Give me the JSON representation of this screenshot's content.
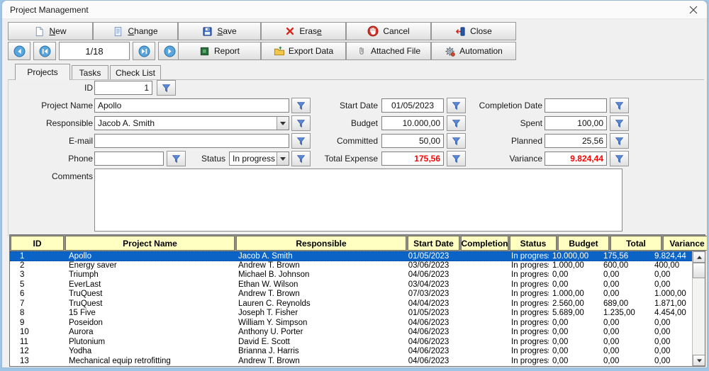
{
  "window": {
    "title": "Project Management"
  },
  "toolbar": {
    "new": {
      "label_html": "<u>N</u>ew"
    },
    "change": {
      "label_html": "<u>C</u>hange"
    },
    "save": {
      "label_html": "<u>S</u>ave"
    },
    "erase": {
      "label_html": "Eras<u>e</u>"
    },
    "cancel": {
      "label_html": "Cancel"
    },
    "close": {
      "label_html": "Close"
    },
    "report": {
      "label_html": "Report"
    },
    "export": {
      "label_html": "Export Data"
    },
    "attached": {
      "label_html": "Attached File"
    },
    "automation": {
      "label_html": "Automation"
    }
  },
  "nav": {
    "counter": "1/18"
  },
  "tabs": {
    "projects": "Projects",
    "tasks": "Tasks",
    "checklist": "Check List"
  },
  "form": {
    "id": {
      "label": "ID",
      "value": "1"
    },
    "project_name": {
      "label": "Project Name",
      "value": "Apollo"
    },
    "responsible": {
      "label": "Responsible",
      "value": "Jacob A. Smith"
    },
    "email": {
      "label": "E-mail",
      "value": ""
    },
    "phone": {
      "label": "Phone",
      "value": ""
    },
    "status": {
      "label": "Status",
      "value": "In progress"
    },
    "start_date": {
      "label": "Start Date",
      "value": "01/05/2023"
    },
    "budget": {
      "label": "Budget",
      "value": "10.000,00"
    },
    "committed": {
      "label": "Committed",
      "value": "50,00"
    },
    "total_expense": {
      "label": "Total Expense",
      "value": "175,56"
    },
    "completion_date": {
      "label": "Completion Date",
      "value": ""
    },
    "spent": {
      "label": "Spent",
      "value": "100,00"
    },
    "planned": {
      "label": "Planned",
      "value": "25,56"
    },
    "variance": {
      "label": "Variance",
      "value": "9.824,44"
    },
    "comments": {
      "label": "Comments",
      "value": ""
    }
  },
  "table": {
    "columns": [
      "ID",
      "Project Name",
      "Responsible",
      "Start Date",
      "Completion",
      "Status",
      "Budget",
      "Total",
      "Variance"
    ],
    "rows": [
      {
        "id": "1",
        "name": "Apollo",
        "resp": "Jacob A. Smith",
        "start": "01/05/2023",
        "comp": "",
        "status": "In progress",
        "budget": "10.000,00",
        "total": "175,56",
        "var": "9.824,44",
        "selected": true
      },
      {
        "id": "2",
        "name": "Energy saver",
        "resp": "Andrew T. Brown",
        "start": "03/06/2023",
        "comp": "",
        "status": "In progress",
        "budget": "1.000,00",
        "total": "600,00",
        "var": "400,00"
      },
      {
        "id": "3",
        "name": "Triumph",
        "resp": "Michael B. Johnson",
        "start": "04/06/2023",
        "comp": "",
        "status": "In progress",
        "budget": "0,00",
        "total": "0,00",
        "var": "0,00"
      },
      {
        "id": "5",
        "name": "EverLast",
        "resp": "Ethan W. Wilson",
        "start": "03/04/2023",
        "comp": "",
        "status": "In progress",
        "budget": "0,00",
        "total": "0,00",
        "var": "0,00"
      },
      {
        "id": "6",
        "name": "TruQuest",
        "resp": "Andrew T. Brown",
        "start": "07/03/2023",
        "comp": "",
        "status": "In progress",
        "budget": "1.000,00",
        "total": "0,00",
        "var": "1.000,00"
      },
      {
        "id": "7",
        "name": "TruQuest",
        "resp": "Lauren C. Reynolds",
        "start": "04/04/2023",
        "comp": "",
        "status": "In progress",
        "budget": "2.560,00",
        "total": "689,00",
        "var": "1.871,00"
      },
      {
        "id": "8",
        "name": "15 Five",
        "resp": "Joseph T. Fisher",
        "start": "01/05/2023",
        "comp": "",
        "status": "In progress",
        "budget": "5.689,00",
        "total": "1.235,00",
        "var": "4.454,00"
      },
      {
        "id": "9",
        "name": "Poseidon",
        "resp": "William Y. Simpson",
        "start": "04/06/2023",
        "comp": "",
        "status": "In progress",
        "budget": "0,00",
        "total": "0,00",
        "var": "0,00"
      },
      {
        "id": "10",
        "name": "Aurora",
        "resp": "Anthony U. Porter",
        "start": "04/06/2023",
        "comp": "",
        "status": "In progress",
        "budget": "0,00",
        "total": "0,00",
        "var": "0,00"
      },
      {
        "id": "11",
        "name": "Plutonium",
        "resp": "David E. Scott",
        "start": "04/06/2023",
        "comp": "",
        "status": "In progress",
        "budget": "0,00",
        "total": "0,00",
        "var": "0,00"
      },
      {
        "id": "12",
        "name": "Yodha",
        "resp": "Brianna J. Harris",
        "start": "04/06/2023",
        "comp": "",
        "status": "In progress",
        "budget": "0,00",
        "total": "0,00",
        "var": "0,00"
      },
      {
        "id": "13",
        "name": "Mechanical equip retrofitting",
        "resp": "Andrew T. Brown",
        "start": "04/06/2023",
        "comp": "",
        "status": "In progress",
        "budget": "0,00",
        "total": "0,00",
        "var": "0,00"
      }
    ]
  },
  "colors": {
    "selected_row": "#0b63c5",
    "header_bg": "#ffffc2",
    "negative_value": "#ff0000",
    "nav_accent": "#58a6dd"
  }
}
